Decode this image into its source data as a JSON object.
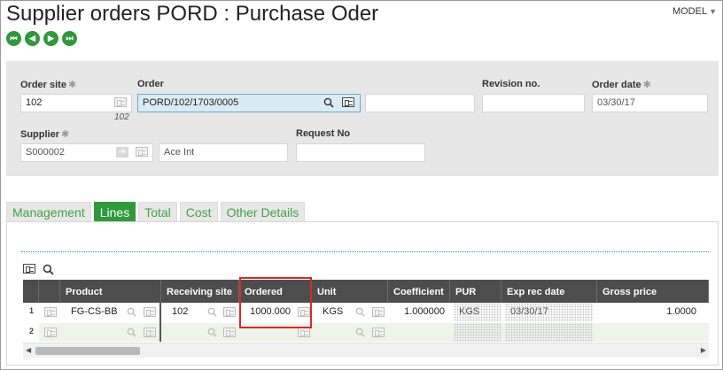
{
  "window": {
    "title": "Supplier orders PORD : Purchase Oder",
    "model_label": "MODEL"
  },
  "nav": {
    "first": "first-record",
    "prev": "previous-record",
    "next": "next-record",
    "last": "last-record"
  },
  "header": {
    "order_site": {
      "label": "Order site",
      "value": "102",
      "sub": "102"
    },
    "order": {
      "label": "Order",
      "value": "PORD/102/1703/0005",
      "extra": ""
    },
    "revision": {
      "label": "Revision no.",
      "value": ""
    },
    "order_date": {
      "label": "Order date",
      "value": "03/30/17"
    },
    "supplier": {
      "label": "Supplier",
      "value": "S000002",
      "name": "Ace Int"
    },
    "request_no": {
      "label": "Request No",
      "value": ""
    }
  },
  "tabs": [
    {
      "label": "Management",
      "active": false
    },
    {
      "label": "Lines",
      "active": true
    },
    {
      "label": "Total",
      "active": false
    },
    {
      "label": "Cost",
      "active": false
    },
    {
      "label": "Other Details",
      "active": false
    }
  ],
  "grid": {
    "columns": [
      "Product",
      "Receiving site",
      "Ordered",
      "Unit",
      "Coefficient",
      "PUR",
      "Exp rec date",
      "Gross price"
    ],
    "rows": [
      {
        "num": "1",
        "product": "FG-CS-BB",
        "site": "102",
        "ordered": "1000.000",
        "unit": "KGS",
        "coefficient": "1.000000",
        "pur": "KGS",
        "exp_date": "03/30/17",
        "gross_price": "1.0000"
      },
      {
        "num": "2",
        "product": "",
        "site": "",
        "ordered": "",
        "unit": "",
        "coefficient": "",
        "pur": "",
        "exp_date": "",
        "gross_price": ""
      }
    ]
  },
  "colors": {
    "accent_green": "#2e9a3a",
    "header_dark": "#4d4d4d",
    "highlight_red": "#d42a2a",
    "focus_blue": "#d9ecf6"
  }
}
